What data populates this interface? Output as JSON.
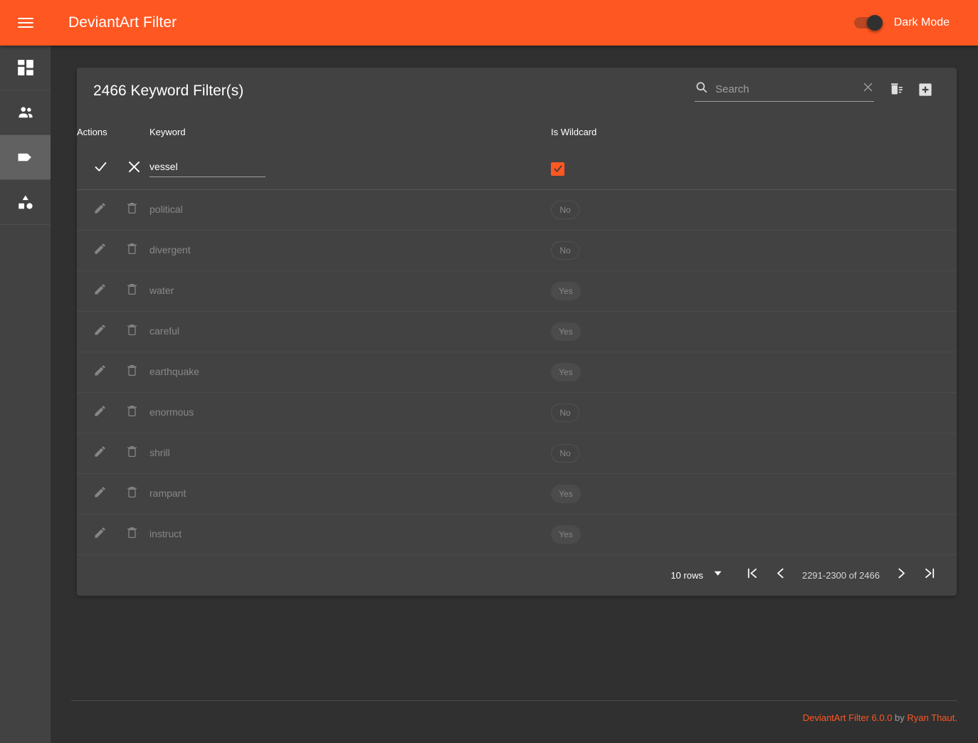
{
  "appbar": {
    "menu_icon": "hamburger-menu-icon",
    "title": "DeviantArt Filter",
    "dark_mode_label": "Dark Mode",
    "dark_mode_on": true,
    "accent_color": "#ff5722"
  },
  "sidebar": {
    "items": [
      {
        "icon": "dashboard-grid-icon",
        "name": "dashboard",
        "active": false
      },
      {
        "icon": "users-icon",
        "name": "users",
        "active": false
      },
      {
        "icon": "tag-icon",
        "name": "keywords",
        "active": true
      },
      {
        "icon": "shapes-icon",
        "name": "categories",
        "active": false
      }
    ]
  },
  "card": {
    "title": "2466 Keyword Filter(s)",
    "search": {
      "placeholder": "Search",
      "value": "",
      "search_icon": "search-icon",
      "clear_icon": "close-icon"
    },
    "actions": [
      {
        "name": "delete-sweep-button",
        "icon": "delete-sweep-icon"
      },
      {
        "name": "add-filter-button",
        "icon": "plus-box-icon"
      }
    ]
  },
  "table": {
    "columns": [
      "Actions",
      "Keyword",
      "Is Wildcard"
    ],
    "edit_row": {
      "confirm_icon": "check-icon",
      "cancel_icon": "close-icon",
      "keyword_value": "vessel",
      "keyword_placeholder": "",
      "is_wildcard_checked": true
    },
    "rows": [
      {
        "keyword": "political",
        "is_wildcard": "No"
      },
      {
        "keyword": "divergent",
        "is_wildcard": "No"
      },
      {
        "keyword": "water",
        "is_wildcard": "Yes"
      },
      {
        "keyword": "careful",
        "is_wildcard": "Yes"
      },
      {
        "keyword": "earthquake",
        "is_wildcard": "Yes"
      },
      {
        "keyword": "enormous",
        "is_wildcard": "No"
      },
      {
        "keyword": "shrill",
        "is_wildcard": "No"
      },
      {
        "keyword": "rampant",
        "is_wildcard": "Yes"
      },
      {
        "keyword": "instruct",
        "is_wildcard": "Yes"
      }
    ]
  },
  "paginator": {
    "rows_per_page_label": "10 rows",
    "range_label": "2291-2300 of 2466",
    "first_icon": "first-page-icon",
    "prev_icon": "chevron-left-icon",
    "next_icon": "chevron-right-icon",
    "last_icon": "last-page-icon"
  },
  "footer": {
    "app_link": "DeviantArt Filter 6.0.0",
    "by_text": " by ",
    "author_link": "Ryan Thaut."
  }
}
